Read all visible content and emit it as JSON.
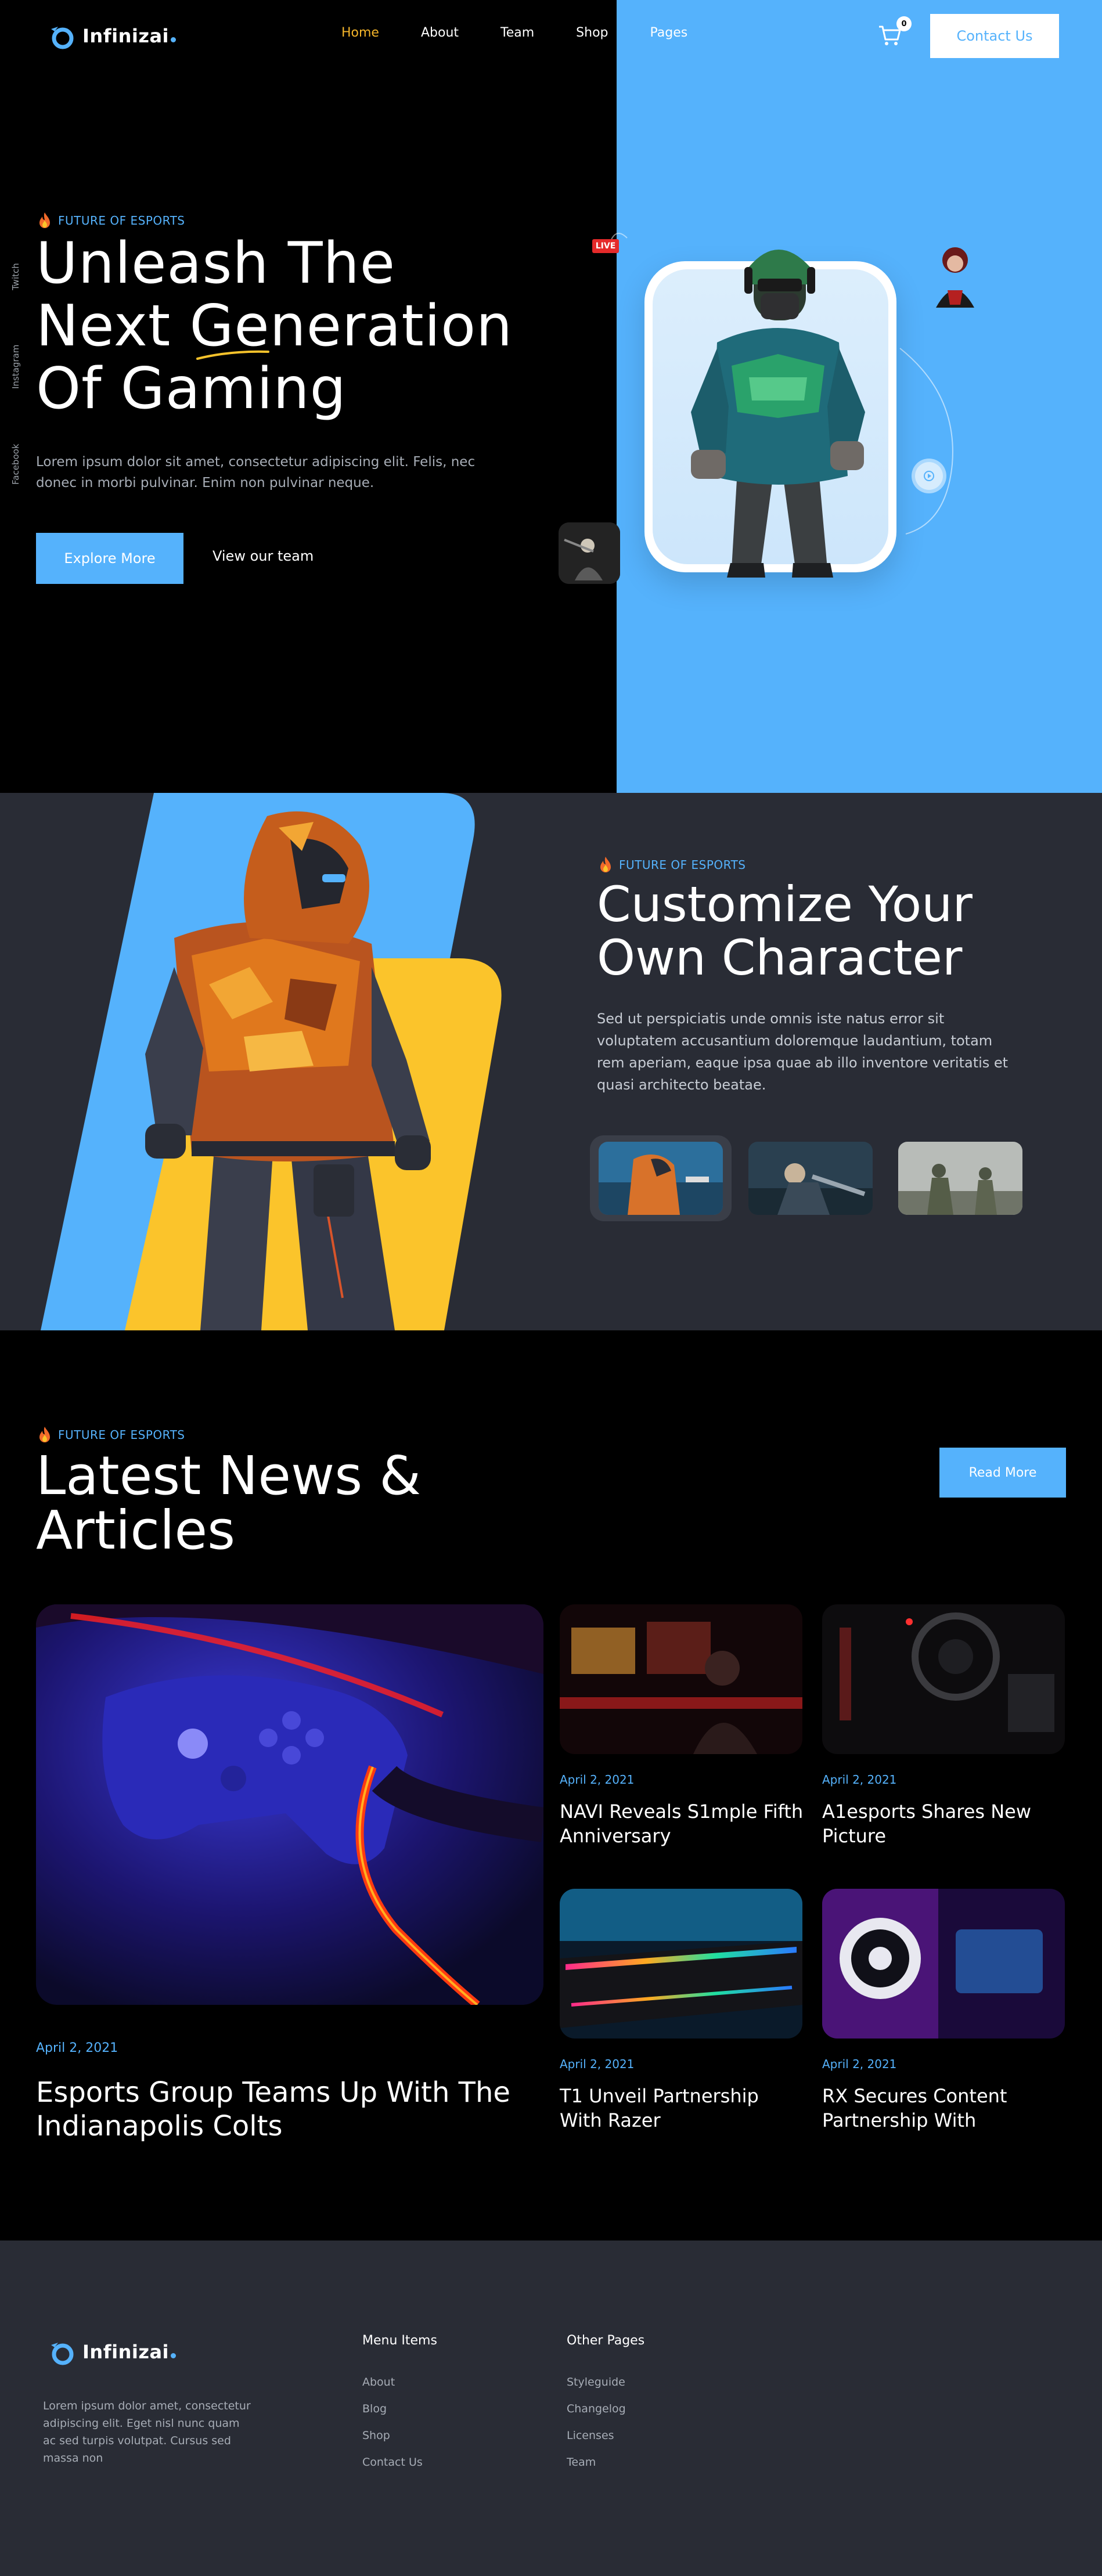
{
  "brand": {
    "name": "Infinizai",
    "accent": "#55b2fc",
    "highlight": "#f5b52a"
  },
  "nav": {
    "items": [
      {
        "label": "Home",
        "active": true
      },
      {
        "label": "About",
        "active": false
      },
      {
        "label": "Team",
        "active": false
      },
      {
        "label": "Shop",
        "active": false
      },
      {
        "label": "Pages",
        "active": false
      }
    ],
    "cart_count": "0",
    "contact_label": "Contact Us"
  },
  "socials": [
    "Twitch",
    "Instagram",
    "Facebook"
  ],
  "hero": {
    "eyebrow": "FUTURE OF ESPORTS",
    "title_line1": "Unleash The",
    "title_line2": "Next Generation",
    "title_line3": "Of Gaming",
    "description": "Lorem ipsum dolor sit amet, consectetur adipiscing elit. Felis, nec donec in morbi pulvinar. Enim non pulvinar neque.",
    "primary_button": "Explore More",
    "secondary_button": "View our team",
    "live_label": "LIVE"
  },
  "customize": {
    "eyebrow": "FUTURE OF ESPORTS",
    "title_line1": "Customize Your",
    "title_line2": "Own Character",
    "description": "Sed ut perspiciatis unde omnis iste natus error sit voluptatem accusantium doloremque laudantium, totam rem aperiam, eaque ipsa quae ab illo inventore veritatis et quasi architecto beatae."
  },
  "news": {
    "eyebrow": "FUTURE OF ESPORTS",
    "title_line1": "Latest News &",
    "title_line2": "Articles",
    "read_more": "Read More",
    "featured": {
      "date": "April 2, 2021",
      "title": "Esports Group Teams Up With The Indianapolis Colts"
    },
    "articles": [
      {
        "date": "April 2, 2021",
        "title": "NAVI Reveals S1mple Fifth Anniversary"
      },
      {
        "date": "April 2, 2021",
        "title": "A1esports Shares New Picture"
      },
      {
        "date": "April 2, 2021",
        "title": "T1 Unveil Partnership With Razer"
      },
      {
        "date": "April 2, 2021",
        "title": "RX Secures Content Partnership With"
      }
    ]
  },
  "footer": {
    "about": "Lorem ipsum dolor amet, consectetur adipiscing elit. Eget nisl nunc quam ac sed turpis volutpat. Cursus sed massa non",
    "menu_title": "Menu Items",
    "menu_items": [
      "About",
      "Blog",
      "Shop",
      "Contact Us"
    ],
    "pages_title": "Other Pages",
    "pages_items": [
      "Styleguide",
      "Changelog",
      "Licenses",
      "Team"
    ]
  }
}
